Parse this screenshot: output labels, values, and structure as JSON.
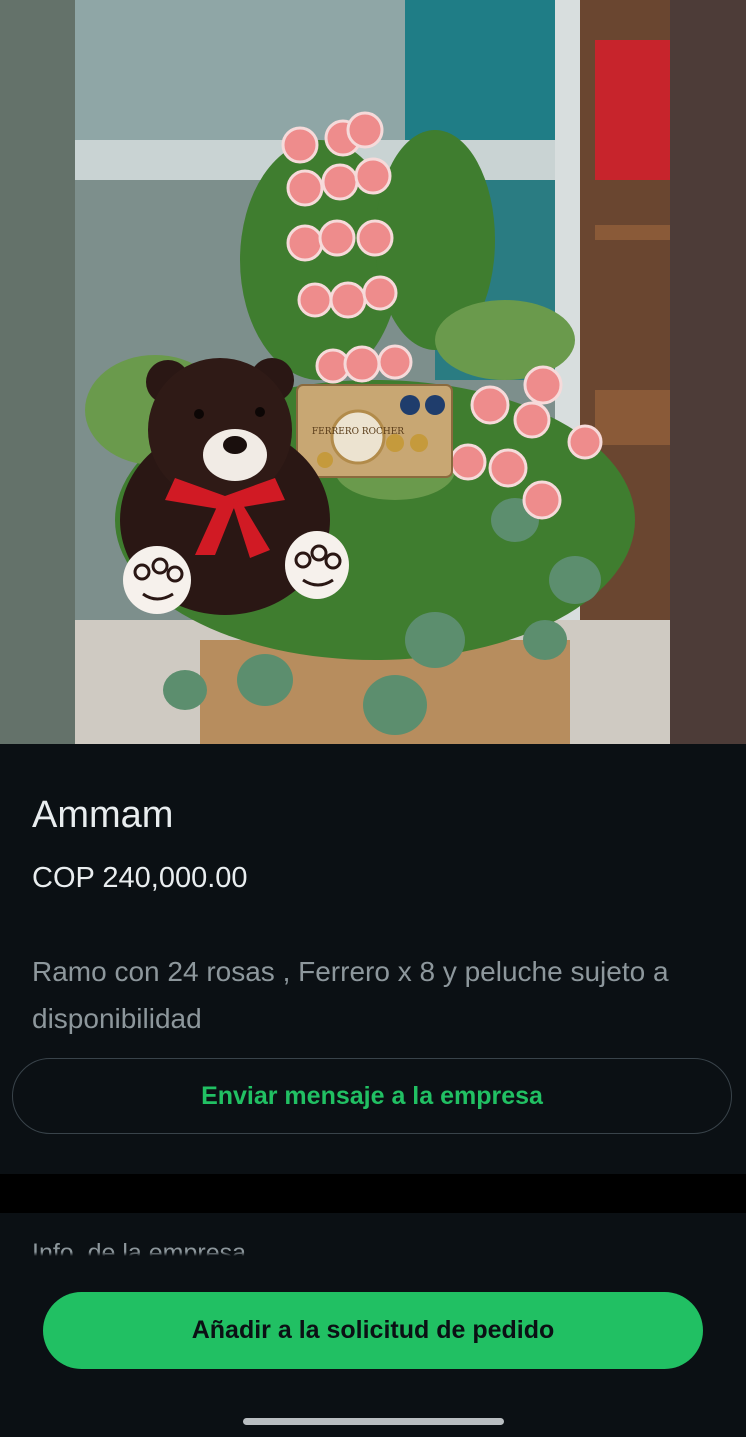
{
  "product": {
    "name": "Ammam",
    "price": "COP 240,000.00",
    "description": "Ramo con 24 rosas , Ferrero x 8 y peluche sujeto a disponibilidad",
    "image_alt": "Arreglo de rosas, chocolates Ferrero Rocher y oso de peluche",
    "chocolate_box_label": "FERRERO ROCHER"
  },
  "actions": {
    "message_label": "Enviar mensaje a la empresa",
    "add_to_order_label": "Añadir a la solicitud de pedido"
  },
  "company": {
    "section_label": "Info. de la empresa"
  },
  "colors": {
    "accent": "#21c063",
    "background": "#0b1014",
    "text_primary": "#e9edef",
    "text_secondary": "#8d979c"
  }
}
